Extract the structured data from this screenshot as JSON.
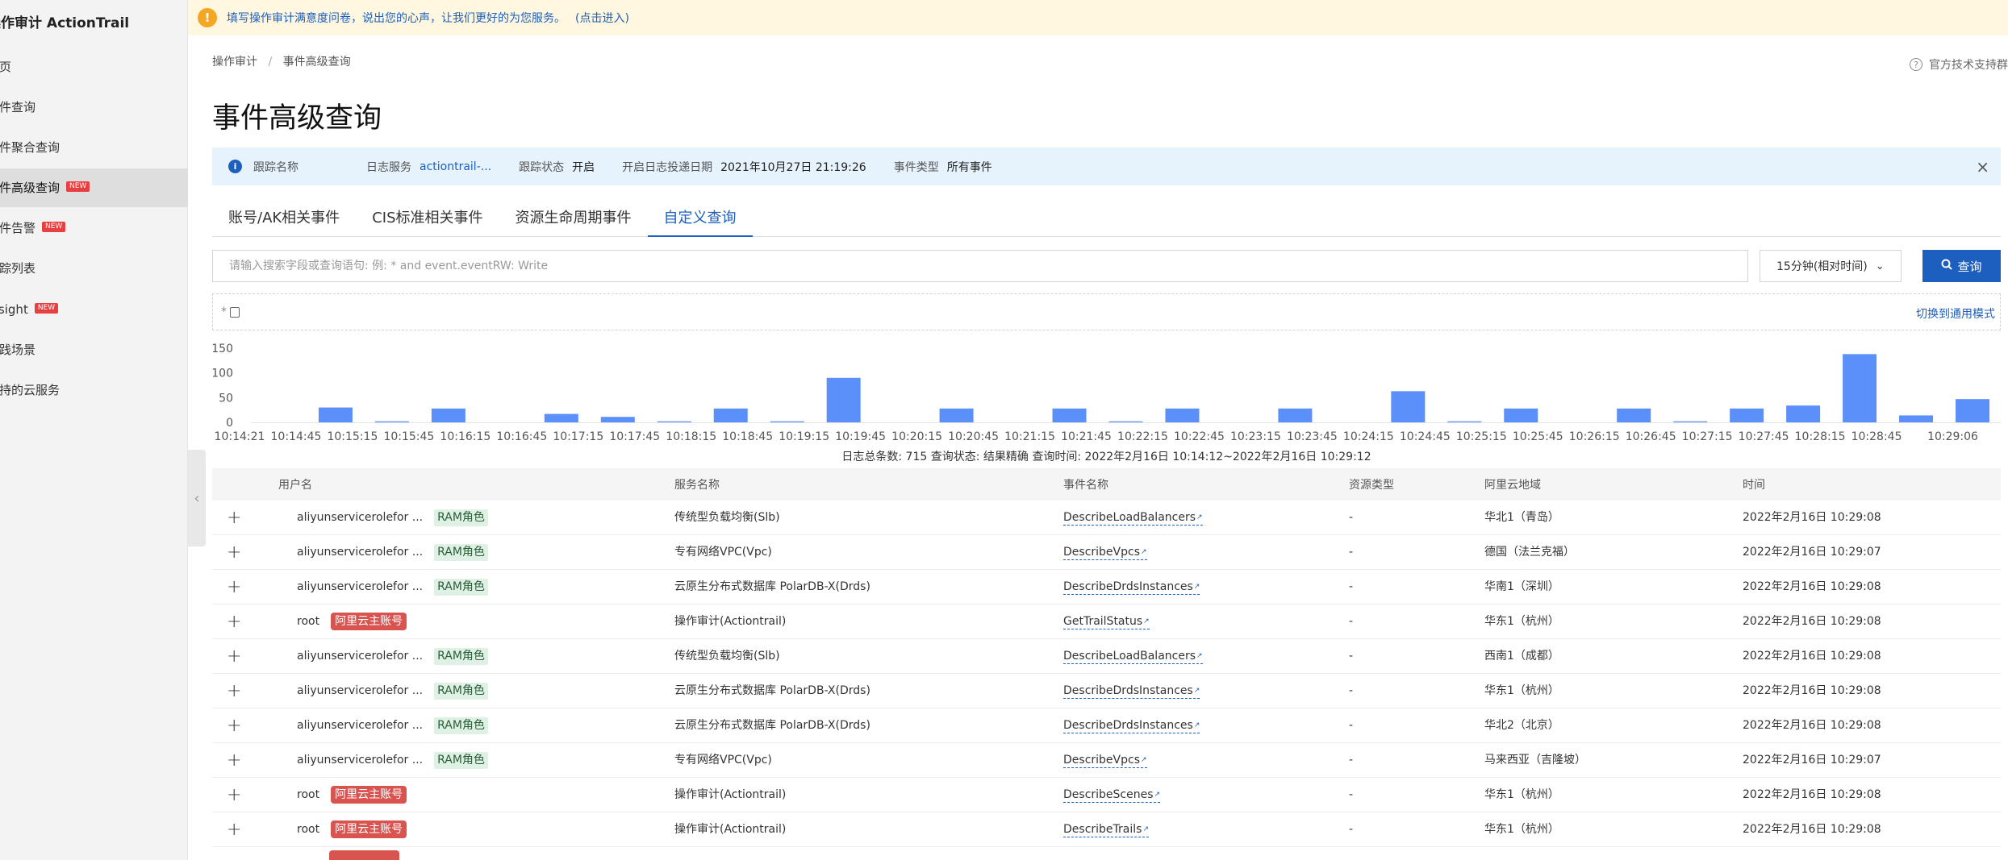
{
  "sidebar": {
    "title_cn": "操作审计",
    "title_en": "ActionTrail",
    "items": [
      {
        "label": "首页",
        "new": false
      },
      {
        "label": "事件查询",
        "new": false
      },
      {
        "label": "事件聚合查询",
        "new": false
      },
      {
        "label": "事件高级查询",
        "new": true,
        "active": true
      },
      {
        "label": "事件告警",
        "new": true
      },
      {
        "label": "跟踪列表",
        "new": false
      },
      {
        "label": "Insight",
        "new": true
      },
      {
        "label": "实践场景",
        "new": false
      },
      {
        "label": "支持的云服务",
        "new": false
      }
    ],
    "new_badge": "NEW"
  },
  "notice": {
    "text": "填写操作审计满意度问卷，说出您的心声，让我们更好的为您服务。",
    "link": "(点击进入)"
  },
  "breadcrumb": [
    "操作审计",
    "事件高级查询"
  ],
  "support_label": "官方技术支持群",
  "page_title": "事件高级查询",
  "info": {
    "trail_name_label": "跟踪名称",
    "trail_name_value": "",
    "log_service_label": "日志服务",
    "log_service_value": "actiontrail-...",
    "status_label": "跟踪状态",
    "status_value": "开启",
    "start_label": "开启日志投递日期",
    "start_value": "2021年10月27日 21:19:26",
    "type_label": "事件类型",
    "type_value": "所有事件"
  },
  "tabs": [
    "账号/AK相关事件",
    "CIS标准相关事件",
    "资源生命周期事件",
    "自定义查询"
  ],
  "search": {
    "placeholder": "请输入搜索字段或查询语句: 例: * and event.eventRW: Write",
    "value": "",
    "time_range": "15分钟(相对时间)",
    "button": "查询"
  },
  "query": {
    "star": "*",
    "switch_label": "切换到通用模式"
  },
  "chart_data": {
    "type": "bar",
    "yticks": [
      150,
      100,
      50,
      0
    ],
    "ylim": [
      0,
      150
    ],
    "xlabels": [
      "10:14:21",
      "10:14:45",
      "10:15:15",
      "10:15:45",
      "10:16:15",
      "10:16:45",
      "10:17:15",
      "10:17:45",
      "10:18:15",
      "10:18:45",
      "10:19:15",
      "10:19:45",
      "10:20:15",
      "10:20:45",
      "10:21:15",
      "10:21:45",
      "10:22:15",
      "10:22:45",
      "10:23:15",
      "10:23:45",
      "10:24:15",
      "10:24:45",
      "10:25:15",
      "10:25:45",
      "10:26:15",
      "10:26:45",
      "10:27:15",
      "10:27:45",
      "10:28:15",
      "10:28:45",
      "10:29:06"
    ],
    "values": [
      0,
      30,
      2,
      28,
      0,
      17,
      11,
      2,
      28,
      2,
      90,
      0,
      28,
      0,
      28,
      2,
      28,
      0,
      28,
      0,
      63,
      2,
      28,
      0,
      28,
      2,
      28,
      34,
      138,
      14,
      47
    ]
  },
  "chart_summary": "日志总条数: 715 查询状态: 结果精确 查询时间: 2022年2月16日 10:14:12~2022年2月16日 10:29:12",
  "table": {
    "headers": [
      "用户名",
      "服务名称",
      "事件名称",
      "资源类型",
      "阿里云地域",
      "时间"
    ],
    "rows": [
      {
        "user": "aliyunservicerolefor ...",
        "tag": "RAM角色",
        "tag_type": "ram",
        "service": "传统型负载均衡(Slb)",
        "event": "DescribeLoadBalancers",
        "resource": "-",
        "region": "华北1（青岛）",
        "time": "2022年2月16日 10:29:08"
      },
      {
        "user": "aliyunservicerolefor ...",
        "tag": "RAM角色",
        "tag_type": "ram",
        "service": "专有网络VPC(Vpc)",
        "event": "DescribeVpcs",
        "resource": "-",
        "region": "德国（法兰克福）",
        "time": "2022年2月16日 10:29:07"
      },
      {
        "user": "aliyunservicerolefor ...",
        "tag": "RAM角色",
        "tag_type": "ram",
        "service": "云原生分布式数据库 PolarDB-X(Drds)",
        "event": "DescribeDrdsInstances",
        "resource": "-",
        "region": "华南1（深圳）",
        "time": "2022年2月16日 10:29:08"
      },
      {
        "user": "root",
        "tag": "阿里云主账号",
        "tag_type": "main",
        "service": "操作审计(Actiontrail)",
        "event": "GetTrailStatus",
        "resource": "-",
        "region": "华东1（杭州）",
        "time": "2022年2月16日 10:29:08"
      },
      {
        "user": "aliyunservicerolefor ...",
        "tag": "RAM角色",
        "tag_type": "ram",
        "service": "传统型负载均衡(Slb)",
        "event": "DescribeLoadBalancers",
        "resource": "-",
        "region": "西南1（成都）",
        "time": "2022年2月16日 10:29:08"
      },
      {
        "user": "aliyunservicerolefor ...",
        "tag": "RAM角色",
        "tag_type": "ram",
        "service": "云原生分布式数据库 PolarDB-X(Drds)",
        "event": "DescribeDrdsInstances",
        "resource": "-",
        "region": "华东1（杭州）",
        "time": "2022年2月16日 10:29:08"
      },
      {
        "user": "aliyunservicerolefor ...",
        "tag": "RAM角色",
        "tag_type": "ram",
        "service": "云原生分布式数据库 PolarDB-X(Drds)",
        "event": "DescribeDrdsInstances",
        "resource": "-",
        "region": "华北2（北京）",
        "time": "2022年2月16日 10:29:08"
      },
      {
        "user": "aliyunservicerolefor ...",
        "tag": "RAM角色",
        "tag_type": "ram",
        "service": "专有网络VPC(Vpc)",
        "event": "DescribeVpcs",
        "resource": "-",
        "region": "马来西亚（吉隆坡）",
        "time": "2022年2月16日 10:29:07"
      },
      {
        "user": "root",
        "tag": "阿里云主账号",
        "tag_type": "main",
        "service": "操作审计(Actiontrail)",
        "event": "DescribeScenes",
        "resource": "-",
        "region": "华东1（杭州）",
        "time": "2022年2月16日 10:29:08"
      },
      {
        "user": "root",
        "tag": "阿里云主账号",
        "tag_type": "main",
        "service": "操作审计(Actiontrail)",
        "event": "DescribeTrails",
        "resource": "-",
        "region": "华东1（杭州）",
        "time": "2022年2月16日 10:29:08"
      }
    ]
  },
  "colors": {
    "accent": "#1c5fbf",
    "bar": "#5b8ff9",
    "ram_tag_bg": "#dff1e4",
    "main_tag_bg": "#d9534f"
  }
}
